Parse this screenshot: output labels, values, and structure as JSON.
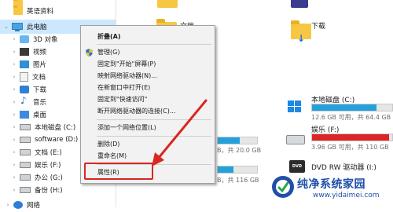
{
  "nav": {
    "items": [
      {
        "label": "",
        "icon": "folder-icon"
      },
      {
        "label": "英语资料",
        "icon": "folder-icon"
      },
      {
        "label": "此电脑",
        "icon": "computer-icon"
      },
      {
        "label": "3D 对象",
        "icon": "3d-objects-icon"
      },
      {
        "label": "视频",
        "icon": "video-icon"
      },
      {
        "label": "图片",
        "icon": "pictures-icon"
      },
      {
        "label": "文档",
        "icon": "documents-icon"
      },
      {
        "label": "下载",
        "icon": "download-icon"
      },
      {
        "label": "音乐",
        "icon": "music-icon"
      },
      {
        "label": "桌面",
        "icon": "desktop-icon"
      },
      {
        "label": "本地磁盘 (C:)",
        "icon": "drive-icon"
      },
      {
        "label": "software (D:)",
        "icon": "drive-icon"
      },
      {
        "label": "文档 (E:)",
        "icon": "drive-icon"
      },
      {
        "label": "娱乐 (F:)",
        "icon": "drive-icon"
      },
      {
        "label": "办公 (G:)",
        "icon": "drive-icon"
      },
      {
        "label": "备份 (H:)",
        "icon": "drive-icon"
      },
      {
        "label": "网络",
        "icon": "network-icon"
      }
    ]
  },
  "content": {
    "folders": [
      {
        "label": "文档"
      },
      {
        "label": "下载"
      }
    ],
    "drives": [
      {
        "label": "本地磁盘 (C:)",
        "free": "12.6 GB 可用，共 64.4 GB",
        "fill_fraction": 0.8,
        "color": "#26a0da"
      },
      {
        "label": "娱乐 (F:)",
        "free": "3.96 GB 可用，共 110 GB",
        "fill_fraction": 0.96,
        "color": "#da2626"
      },
      {
        "label": "DVD RW 驱动器 (I:)"
      }
    ],
    "partial": {
      "free1": "B，共 20.0 GB",
      "free2": "B，共 116 GB"
    }
  },
  "context_menu": {
    "items": [
      {
        "label": "折叠(A)",
        "bold": true
      },
      {
        "label": "管理(G)",
        "icon": "shield-icon"
      },
      {
        "label": "固定到\"开始\"屏幕(P)"
      },
      {
        "label": "映射网络驱动器(N)..."
      },
      {
        "label": "在新窗口中打开(E)"
      },
      {
        "label": "固定到\"快速访问\""
      },
      {
        "label": "断开网络驱动器的连接(C)..."
      },
      {
        "label": "添加一个网络位置(L)"
      },
      {
        "label": "删除(D)"
      },
      {
        "label": "重命名(M)"
      },
      {
        "label": "属性(R)"
      }
    ]
  },
  "annotation": {
    "color": "#d8281f"
  },
  "watermark": {
    "title": "纯净系统家园",
    "url": "www.yidaimei.com"
  }
}
